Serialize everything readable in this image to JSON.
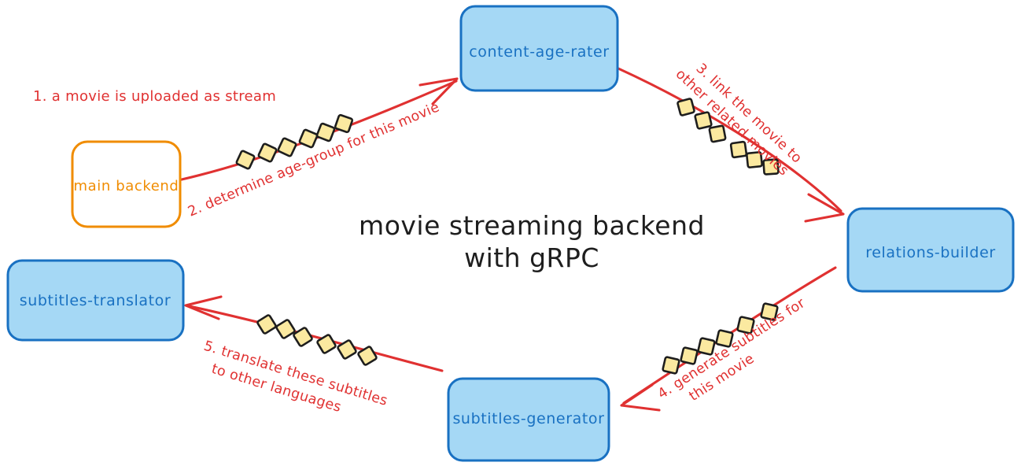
{
  "diagram": {
    "title_line1": "movie streaming backend",
    "title_line2": "with gRPC",
    "colors": {
      "node_fill_blue": "#a5d8f5",
      "node_stroke_blue": "#1971c2",
      "node_text_blue": "#1971c2",
      "node_stroke_orange": "#f08c00",
      "node_text_orange": "#f08c00",
      "node_fill_white": "#ffffff",
      "edge_red": "#e03131",
      "packet_fill": "#fbe9a0",
      "packet_stroke": "#1e1e1e",
      "title_color": "#1e1e1e",
      "background": "#ffffff"
    },
    "nodes": [
      {
        "id": "main-backend",
        "label": "main backend",
        "style": "orange"
      },
      {
        "id": "content-age-rater",
        "label": "content-age-rater",
        "style": "blue"
      },
      {
        "id": "relations-builder",
        "label": "relations-builder",
        "style": "blue"
      },
      {
        "id": "subtitles-generator",
        "label": "subtitles-generator",
        "style": "blue"
      },
      {
        "id": "subtitles-translator",
        "label": "subtitles-translator",
        "style": "blue"
      }
    ],
    "edges": [
      {
        "id": "edge-1",
        "from": "",
        "to": "main-backend",
        "label": "1. a movie is uploaded as stream",
        "lines": [
          "1. a movie is uploaded as stream"
        ],
        "has_arrow": false,
        "packets": 0
      },
      {
        "id": "edge-2",
        "from": "main-backend",
        "to": "content-age-rater",
        "label": "2. determine age-group for this movie",
        "lines": [
          "2. determine age-group for this movie"
        ],
        "has_arrow": true,
        "packets": 6
      },
      {
        "id": "edge-3",
        "from": "content-age-rater",
        "to": "relations-builder",
        "label": "3. link the movie to other related movies",
        "lines": [
          "3. link the movie to",
          "other related movies"
        ],
        "has_arrow": true,
        "packets": 6
      },
      {
        "id": "edge-4",
        "from": "relations-builder",
        "to": "subtitles-generator",
        "label": "4. generate subtitles for this movie",
        "lines": [
          "4. generate subtitles for",
          "this movie"
        ],
        "has_arrow": true,
        "packets": 6
      },
      {
        "id": "edge-5",
        "from": "subtitles-generator",
        "to": "subtitles-translator",
        "label": "5. translate these subtitles to other languages",
        "lines": [
          "5. translate these subtitles",
          "to other languages"
        ],
        "has_arrow": true,
        "packets": 6
      }
    ]
  }
}
